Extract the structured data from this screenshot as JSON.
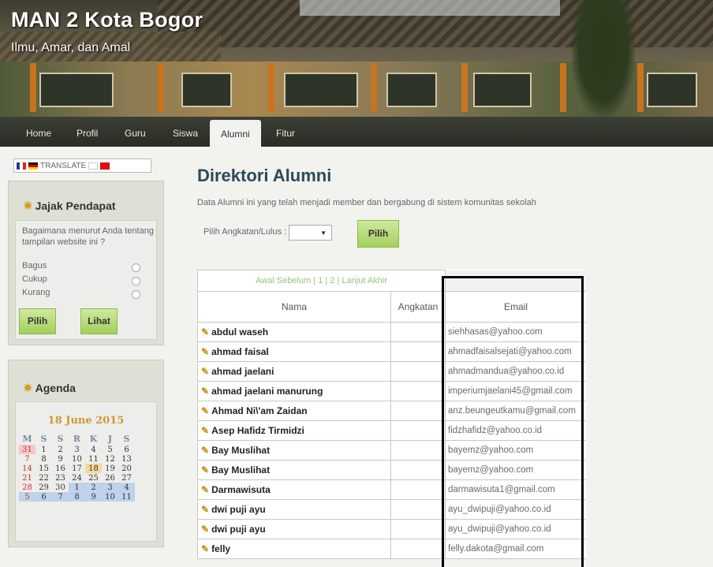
{
  "header": {
    "title": "MAN 2 Kota Bogor",
    "tagline": "Ilmu, Amar, dan Amal"
  },
  "nav": {
    "items": [
      {
        "label": "Home"
      },
      {
        "label": "Profil"
      },
      {
        "label": "Guru"
      },
      {
        "label": "Siswa"
      },
      {
        "label": "Alumni",
        "active": true
      },
      {
        "label": "Fitur"
      }
    ]
  },
  "translate": {
    "label": "TRANSLATE"
  },
  "poll": {
    "title": "Jajak Pendapat",
    "question": "Bagaimana menurut Anda tentang tampilan website ini ?",
    "options": [
      "Bagus",
      "Cukup",
      "Kurang"
    ],
    "vote_label": "Pilih",
    "view_label": "Lihat"
  },
  "agenda": {
    "title": "Agenda",
    "date": "18 June 2015",
    "weekdays": [
      "M",
      "S",
      "S",
      "R",
      "K",
      "J",
      "S"
    ],
    "weeks": [
      [
        "31",
        "1",
        "2",
        "3",
        "4",
        "5",
        "6"
      ],
      [
        "7",
        "8",
        "9",
        "10",
        "11",
        "12",
        "13"
      ],
      [
        "14",
        "15",
        "16",
        "17",
        "18",
        "19",
        "20"
      ],
      [
        "21",
        "22",
        "23",
        "24",
        "25",
        "26",
        "27"
      ],
      [
        "28",
        "29",
        "30",
        "1",
        "2",
        "3",
        "4"
      ],
      [
        "5",
        "6",
        "7",
        "8",
        "9",
        "10",
        "11"
      ]
    ]
  },
  "main": {
    "heading": "Direktori Alumni",
    "description": "Data Alumni ini yang telah menjadi member dan bergabung di sistem komunitas sekolah",
    "filter_label": "Pilih Angkatan/Lulus :",
    "filter_button": "Pilih",
    "pager": {
      "first": "Awal",
      "prev": "Sebelum",
      "pages": [
        "1",
        "2"
      ],
      "next": "Lanjut",
      "last": "Akhir"
    },
    "columns": [
      "Nama",
      "Angkatan",
      "Email"
    ],
    "rows": [
      {
        "name": "abdul waseh",
        "email": "siehhasas@yahoo.com"
      },
      {
        "name": "ahmad faisal",
        "email": "ahmadfaisalsejati@yahoo.com"
      },
      {
        "name": "ahmad jaelani",
        "email": "ahmadmandua@yahoo.co.id"
      },
      {
        "name": "ahmad jaelani manurung",
        "email": "imperiumjaelani45@gmail.com"
      },
      {
        "name": "Ahmad Ni\\'am Zaidan",
        "email": "anz.beungeutkamu@gmail.com"
      },
      {
        "name": "Asep Hafidz Tirmidzi",
        "email": "fidzhafidz@yahoo.co.id"
      },
      {
        "name": "Bay Muslihat",
        "email": "bayemz@yahoo.com"
      },
      {
        "name": "Bay Muslihat",
        "email": "bayemz@yahoo.com"
      },
      {
        "name": "Darmawisuta",
        "email": "darmawisuta1@gmail.com"
      },
      {
        "name": "dwi puji ayu",
        "email": "ayu_dwipuji@yahoo.co.id"
      },
      {
        "name": "dwi puji ayu",
        "email": "ayu_dwipuji@yahoo.co.id"
      },
      {
        "name": "felly",
        "email": "felly.dakota@gmail.com"
      }
    ]
  }
}
